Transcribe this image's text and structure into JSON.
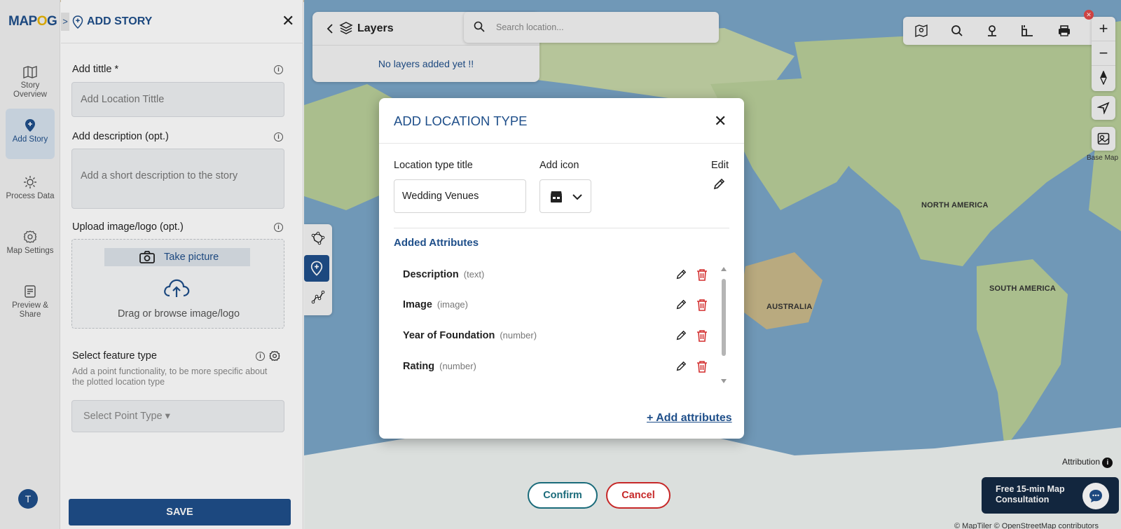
{
  "brand": {
    "logo_left": "MAP",
    "logo_mark": "O",
    "logo_right": "G"
  },
  "rail": {
    "items": [
      {
        "label": "Story Overview",
        "icon": "map-icon"
      },
      {
        "label": "Add Story",
        "icon": "add-pin-icon"
      },
      {
        "label": "Process Data",
        "icon": "process-icon"
      },
      {
        "label": "Map Settings",
        "icon": "gear-icon"
      },
      {
        "label": "Preview & Share",
        "icon": "preview-icon"
      }
    ],
    "avatar_initial": "T"
  },
  "panel": {
    "chevron": ">",
    "title": "ADD STORY",
    "close": "✕",
    "title_label": "Add tittle *",
    "title_placeholder": "Add Location Tittle",
    "desc_label": "Add description (opt.)",
    "desc_placeholder": "Add a short description to the story",
    "upload_label": "Upload image/logo (opt.)",
    "take_picture": "Take picture",
    "drag_text": "Drag or browse image/logo",
    "feature_label": "Select feature type",
    "feature_help": "Add a point functionality, to be more specific about the plotted location type",
    "point_type_placeholder": "Select Point Type ▾",
    "save_label": "SAVE"
  },
  "map": {
    "layers_title": "Layers",
    "layers_empty": "No layers added yet !!",
    "search_placeholder": "Search location...",
    "zoom_in": "+",
    "zoom_out": "−",
    "basemap_label": "Base Map",
    "labels": {
      "north_america": "NORTH AMERICA",
      "south_america": "SOUTH AMERICA",
      "australia": "AUSTRALIA"
    },
    "attribution": "Attribution",
    "copyright": "© MapTiler © OpenStreetMap contributors",
    "consult_text": "Free 15-min Map Consultation"
  },
  "modal": {
    "title": "ADD LOCATION TYPE",
    "close": "✕",
    "type_title_label": "Location type title",
    "type_title_value": "Wedding Venues",
    "add_icon_label": "Add icon",
    "edit_label": "Edit",
    "attributes_heading": "Added Attributes",
    "attributes": [
      {
        "name": "Description",
        "type": "(text)"
      },
      {
        "name": "Image",
        "type": "(image)"
      },
      {
        "name": "Year of Foundation",
        "type": "(number)"
      },
      {
        "name": "Rating",
        "type": "(number)"
      }
    ],
    "add_attributes": "+ Add attributes"
  },
  "actions": {
    "confirm": "Confirm",
    "cancel": "Cancel"
  },
  "colors": {
    "brand": "#1f4f8a",
    "confirm": "#1a6b7a",
    "cancel": "#c62828",
    "delete_icon": "#d32f2f"
  }
}
